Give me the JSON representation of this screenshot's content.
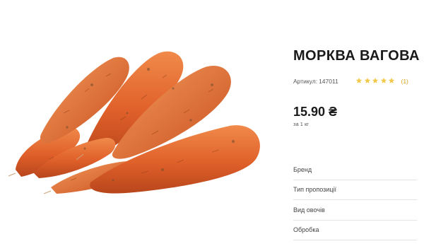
{
  "product": {
    "title": "МОРКВА ВАГОВА",
    "sku_label": "Артикул:",
    "sku_value": "147011",
    "rating": {
      "stars": 5,
      "count": "(1)",
      "star_color": "#f2c94c",
      "count_color": "#d4a017"
    },
    "price": "15.90 ₴",
    "unit": "за 1 кг",
    "image": {
      "icon": "carrots-image"
    }
  },
  "properties": [
    {
      "label": "Бренд"
    },
    {
      "label": "Тип пропозиції"
    },
    {
      "label": "Вид овочів"
    },
    {
      "label": "Обробка"
    }
  ]
}
